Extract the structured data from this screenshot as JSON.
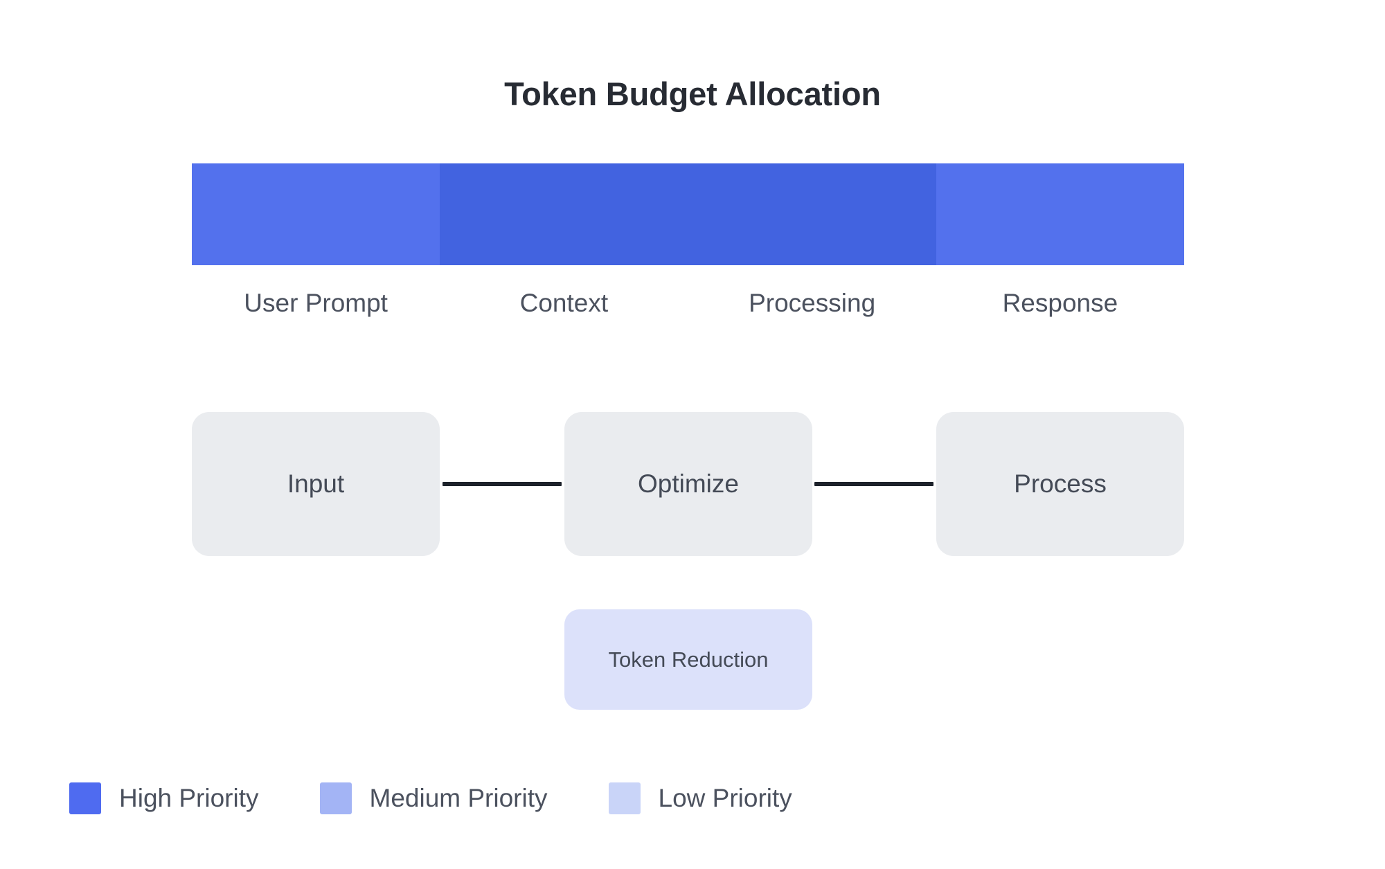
{
  "header": {
    "title": "Token Budget Allocation"
  },
  "chart_data": {
    "type": "bar",
    "title": "Token Budget Allocation",
    "orientation": "horizontal-stacked",
    "xlabel": "",
    "ylabel": "",
    "grid": false,
    "legend_position": "bottom-left",
    "categories": [
      "User Prompt",
      "Context",
      "Processing",
      "Response"
    ],
    "values": [
      25,
      25,
      25,
      25
    ],
    "value_unit": "percent",
    "colors": [
      "#5371ed",
      "#4263e0",
      "#4263e0",
      "#5371ed"
    ],
    "series": [
      {
        "name": "Token Budget Allocation",
        "values": [
          25,
          25,
          25,
          25
        ]
      }
    ],
    "legend": [
      {
        "label": "High Priority",
        "color": "#4f6bf0"
      },
      {
        "label": "Medium Priority",
        "color": "#a3b4f5"
      },
      {
        "label": "Low Priority",
        "color": "#c9d4f8"
      }
    ],
    "annotations": {
      "flow_nodes": [
        "Input",
        "Optimize",
        "Process"
      ],
      "sub_node": "Token Reduction"
    }
  },
  "bar": {
    "segments": [
      {
        "label": "User Prompt",
        "color": "#5371ed"
      },
      {
        "label": "Context",
        "color": "#4263e0"
      },
      {
        "label": "Processing",
        "color": "#4263e0"
      },
      {
        "label": "Response",
        "color": "#5371ed"
      }
    ]
  },
  "flow": {
    "nodes": [
      {
        "label": "Input"
      },
      {
        "label": "Optimize"
      },
      {
        "label": "Process"
      }
    ],
    "sub_node": {
      "label": "Token Reduction"
    },
    "node_color": "#eaecef",
    "sub_node_color": "#dce1fa",
    "connector_color": "#1d222b"
  },
  "legend": {
    "items": [
      {
        "label": "High Priority",
        "color": "#4f6bf0"
      },
      {
        "label": "Medium Priority",
        "color": "#a3b4f5"
      },
      {
        "label": "Low Priority",
        "color": "#c9d4f8"
      }
    ]
  }
}
